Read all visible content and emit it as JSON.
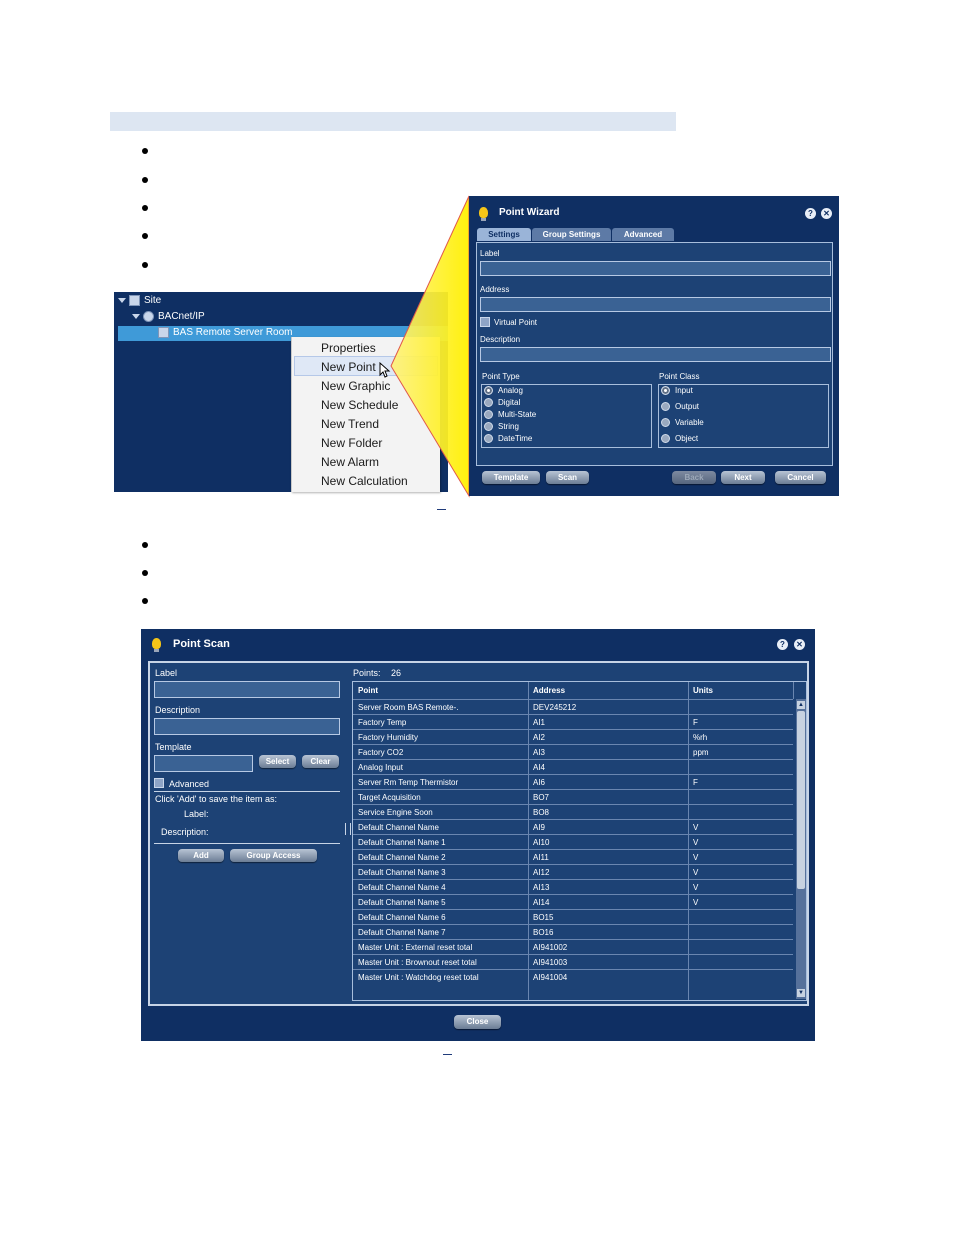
{
  "tree": {
    "site": "Site",
    "bacnet": "BACnet/IP",
    "device": "BAS Remote Server Room"
  },
  "context_menu": {
    "items": [
      "Properties",
      "New Point",
      "New Graphic",
      "New Schedule",
      "New Trend",
      "New Folder",
      "New Alarm",
      "New Calculation"
    ],
    "hovered": "New Point"
  },
  "wizard": {
    "title": "Point Wizard",
    "help": "?",
    "close": "✕",
    "tabs": [
      "Settings",
      "Group Settings",
      "Advanced"
    ],
    "active_tab": "Settings",
    "label_label": "Label",
    "address_label": "Address",
    "virtual_point": "Virtual Point",
    "description_label": "Description",
    "point_type_label": "Point Type",
    "point_types": [
      "Analog",
      "Digital",
      "Multi-State",
      "String",
      "DateTime"
    ],
    "point_class_label": "Point Class",
    "point_classes": [
      "Input",
      "Output",
      "Variable",
      "Object"
    ],
    "buttons": {
      "template": "Template",
      "scan": "Scan",
      "back": "Back",
      "next": "Next",
      "cancel": "Cancel"
    }
  },
  "scan": {
    "title": "Point Scan",
    "help": "?",
    "close": "✕",
    "label_label": "Label",
    "description_label": "Description",
    "template_label": "Template",
    "select": "Select",
    "clear": "Clear",
    "advanced": "Advanced",
    "save_hint": "Click 'Add' to save the item as:",
    "save_label": "Label:",
    "save_description": "Description:",
    "add": "Add",
    "group_access": "Group Access",
    "points_label": "Points:",
    "points_count": "26",
    "columns": [
      "Point",
      "Address",
      "Units"
    ],
    "rows": [
      [
        "Server Room BAS Remote-.",
        "DEV245212",
        ""
      ],
      [
        "Factory Temp",
        "AI1",
        "F"
      ],
      [
        "Factory Humidity",
        "AI2",
        "%rh"
      ],
      [
        "Factory CO2",
        "AI3",
        "ppm"
      ],
      [
        "Analog Input",
        "AI4",
        ""
      ],
      [
        "Server Rm Temp Thermistor",
        "AI6",
        "F"
      ],
      [
        "Target Acquisition",
        "BO7",
        ""
      ],
      [
        "Service Engine Soon",
        "BO8",
        ""
      ],
      [
        "Default Channel Name",
        "AI9",
        "V"
      ],
      [
        "Default Channel Name 1",
        "AI10",
        "V"
      ],
      [
        "Default Channel Name 2",
        "AI11",
        "V"
      ],
      [
        "Default Channel Name 3",
        "AI12",
        "V"
      ],
      [
        "Default Channel Name 4",
        "AI13",
        "V"
      ],
      [
        "Default Channel Name 5",
        "AI14",
        "V"
      ],
      [
        "Default Channel Name 6",
        "BO15",
        ""
      ],
      [
        "Default Channel Name 7",
        "BO16",
        ""
      ],
      [
        "Master Unit : External reset total",
        "AI941002",
        ""
      ],
      [
        "Master Unit : Brownout reset total",
        "AI941003",
        ""
      ],
      [
        "Master Unit : Watchdog reset total",
        "AI941004",
        ""
      ]
    ],
    "close_button": "Close"
  }
}
